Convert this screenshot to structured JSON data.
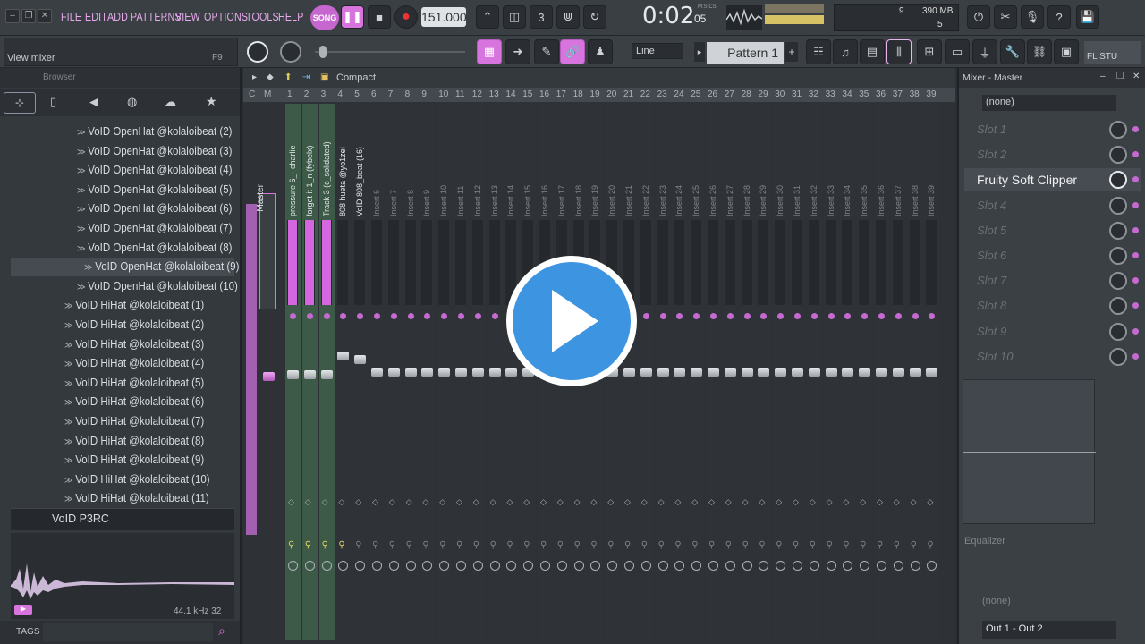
{
  "menu": [
    "FILE",
    "EDIT",
    "ADD",
    "PATTERNS",
    "VIEW",
    "OPTIONS",
    "TOOLS",
    "HELP"
  ],
  "transport": {
    "mode": "SONG",
    "tempo": "151.000",
    "time": "0:02",
    "time_small": "05",
    "meter_label": "M:S:CS"
  },
  "cpu": {
    "value": "9",
    "ram": "390 MB",
    "voices": "5"
  },
  "hint": "View mixer",
  "hint_key": "F9",
  "snap": "Line",
  "pattern": "Pattern 1",
  "fl_label": "FL STU",
  "browser": {
    "title": "Browser",
    "items": [
      {
        "label": "VoID OpenHat @kolaloibeat (2)",
        "indent": 1
      },
      {
        "label": "VoID OpenHat @kolaloibeat (3)",
        "indent": 1
      },
      {
        "label": "VoID OpenHat @kolaloibeat (4)",
        "indent": 1
      },
      {
        "label": "VoID OpenHat @kolaloibeat (5)",
        "indent": 1
      },
      {
        "label": "VoID OpenHat @kolaloibeat (6)",
        "indent": 1
      },
      {
        "label": "VoID OpenHat @kolaloibeat (7)",
        "indent": 1
      },
      {
        "label": "VoID OpenHat @kolaloibeat (8)",
        "indent": 1
      },
      {
        "label": "VoID OpenHat @kolaloibeat (9)",
        "indent": 1,
        "selected": true
      },
      {
        "label": "VoID OpenHat @kolaloibeat (10)",
        "indent": 1
      },
      {
        "label": "VoID HiHat @kolaloibeat (1)",
        "indent": 0
      },
      {
        "label": "VoID HiHat @kolaloibeat (2)",
        "indent": 0
      },
      {
        "label": "VoID HiHat @kolaloibeat (3)",
        "indent": 0
      },
      {
        "label": "VoID HiHat @kolaloibeat (4)",
        "indent": 0
      },
      {
        "label": "VoID HiHat @kolaloibeat (5)",
        "indent": 0
      },
      {
        "label": "VoID HiHat @kolaloibeat (6)",
        "indent": 0
      },
      {
        "label": "VoID HiHat @kolaloibeat (7)",
        "indent": 0
      },
      {
        "label": "VoID HiHat @kolaloibeat (8)",
        "indent": 0
      },
      {
        "label": "VoID HiHat @kolaloibeat (9)",
        "indent": 0
      },
      {
        "label": "VoID HiHat @kolaloibeat (10)",
        "indent": 0
      },
      {
        "label": "VoID HiHat @kolaloibeat (11)",
        "indent": 0
      }
    ],
    "folder": "VoID P3RC",
    "sample_info": "44.1 kHz 32",
    "tags": "TAGS"
  },
  "mixer": {
    "view": "Compact",
    "master": "Master",
    "header_letters": [
      "C",
      "M"
    ],
    "tracks": [
      "pressure 6_- charlie",
      "forget it 1_n (fybelx)",
      "Track 3 (c_solidated)",
      "808 hueta @yo1zel",
      "VoID 808_beat (16)"
    ],
    "insert_prefix": "Insert",
    "numbers": [
      "1",
      "2",
      "3",
      "4",
      "5",
      "6",
      "7",
      "8",
      "9",
      "10",
      "11",
      "12",
      "13",
      "14",
      "15",
      "16",
      "17",
      "18",
      "19",
      "20",
      "21",
      "22",
      "23",
      "24",
      "25",
      "26",
      "27",
      "28",
      "29",
      "30",
      "31",
      "32",
      "33",
      "34",
      "35",
      "36",
      "37",
      "38",
      "39"
    ]
  },
  "right": {
    "title": "Mixer - Master",
    "preset": "(none)",
    "slots": [
      "Slot 1",
      "Slot 2",
      "Fruity Soft Clipper",
      "Slot 4",
      "Slot 5",
      "Slot 6",
      "Slot 7",
      "Slot 8",
      "Slot 9",
      "Slot 10"
    ],
    "eq": "Equalizer",
    "bottom_preset": "(none)",
    "output": "Out 1 - Out 2"
  }
}
